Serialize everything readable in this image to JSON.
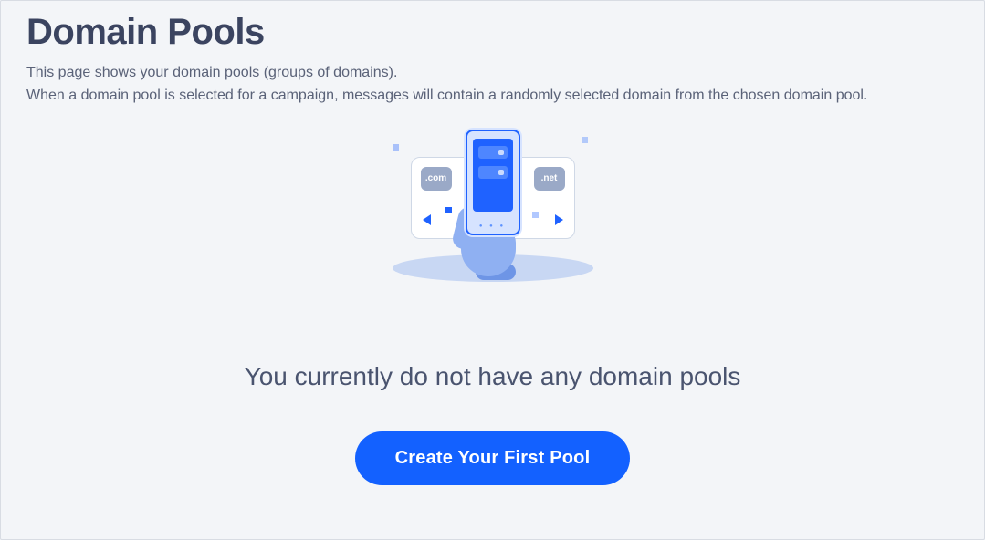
{
  "page": {
    "title": "Domain Pools",
    "description_line1": "This page shows your domain pools (groups of domains).",
    "description_line2": "When a domain pool is selected for a campaign, messages will contain a randomly selected domain from the chosen domain pool."
  },
  "empty_state": {
    "message": "You currently do not have any domain pools",
    "cta_label": "Create Your First Pool",
    "illustration": {
      "tld_left": ".com",
      "tld_right": ".net"
    }
  }
}
